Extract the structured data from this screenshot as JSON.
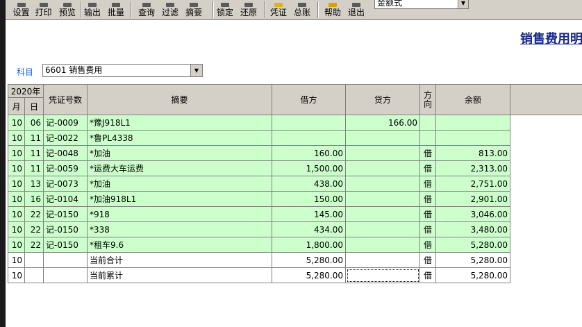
{
  "toolbar": {
    "buttons": [
      {
        "label": "设置",
        "icon": "settings-icon"
      },
      {
        "label": "打印",
        "icon": "print-icon"
      },
      {
        "label": "预览",
        "icon": "preview-icon"
      },
      {
        "label": "输出",
        "icon": "export-icon"
      },
      {
        "label": "批量",
        "icon": "batch-icon"
      },
      {
        "label": "查询",
        "icon": "query-icon"
      },
      {
        "label": "过滤",
        "icon": "filter-icon"
      },
      {
        "label": "摘要",
        "icon": "summary-icon"
      },
      {
        "label": "锁定",
        "icon": "lock-icon"
      },
      {
        "label": "还原",
        "icon": "restore-icon"
      },
      {
        "label": "凭证",
        "icon": "voucher-icon"
      },
      {
        "label": "总账",
        "icon": "ledger-icon"
      },
      {
        "label": "帮助",
        "icon": "help-icon"
      },
      {
        "label": "退出",
        "icon": "exit-icon"
      }
    ],
    "style_select_value": "金额式"
  },
  "page_title": "销售费用明",
  "subject": {
    "label": "科目",
    "value": "6601 销售费用"
  },
  "table": {
    "year_header": "2020年",
    "month_header": "月",
    "day_header": "日",
    "voucher_header": "凭证号数",
    "summary_header": "摘要",
    "debit_header": "借方",
    "credit_header": "贷方",
    "direction_header": "方向",
    "balance_header": "余额",
    "rows": [
      {
        "month": "10",
        "day": "06",
        "voucher": "记-0009",
        "summary": "*豫J918L1",
        "debit": "",
        "credit": "166.00",
        "direction": "",
        "balance": ""
      },
      {
        "month": "10",
        "day": "11",
        "voucher": "记-0022",
        "summary": "*鲁PL4338",
        "debit": "",
        "credit": "",
        "direction": "",
        "balance": ""
      },
      {
        "month": "10",
        "day": "11",
        "voucher": "记-0048",
        "summary": "*加油",
        "debit": "160.00",
        "credit": "",
        "direction": "借",
        "balance": "813.00"
      },
      {
        "month": "10",
        "day": "11",
        "voucher": "记-0059",
        "summary": "*运费大车运费",
        "debit": "1,500.00",
        "credit": "",
        "direction": "借",
        "balance": "2,313.00"
      },
      {
        "month": "10",
        "day": "13",
        "voucher": "记-0073",
        "summary": "*加油",
        "debit": "438.00",
        "credit": "",
        "direction": "借",
        "balance": "2,751.00"
      },
      {
        "month": "10",
        "day": "16",
        "voucher": "记-0104",
        "summary": "*加油918L1",
        "debit": "150.00",
        "credit": "",
        "direction": "借",
        "balance": "2,901.00"
      },
      {
        "month": "10",
        "day": "22",
        "voucher": "记-0150",
        "summary": "*918",
        "debit": "145.00",
        "credit": "",
        "direction": "借",
        "balance": "3,046.00"
      },
      {
        "month": "10",
        "day": "22",
        "voucher": "记-0150",
        "summary": "*338",
        "debit": "434.00",
        "credit": "",
        "direction": "借",
        "balance": "3,480.00"
      },
      {
        "month": "10",
        "day": "22",
        "voucher": "记-0150",
        "summary": "*租车9.6",
        "debit": "1,800.00",
        "credit": "",
        "direction": "借",
        "balance": "5,280.00"
      }
    ],
    "totals": [
      {
        "month": "10",
        "day": "",
        "voucher": "",
        "summary": "当前合计",
        "debit": "5,280.00",
        "credit": "",
        "direction": "借",
        "balance": "5,280.00"
      },
      {
        "month": "10",
        "day": "",
        "voucher": "",
        "summary": "当前累计",
        "debit": "5,280.00",
        "credit": "",
        "direction": "借",
        "balance": "5,280.00"
      }
    ]
  }
}
